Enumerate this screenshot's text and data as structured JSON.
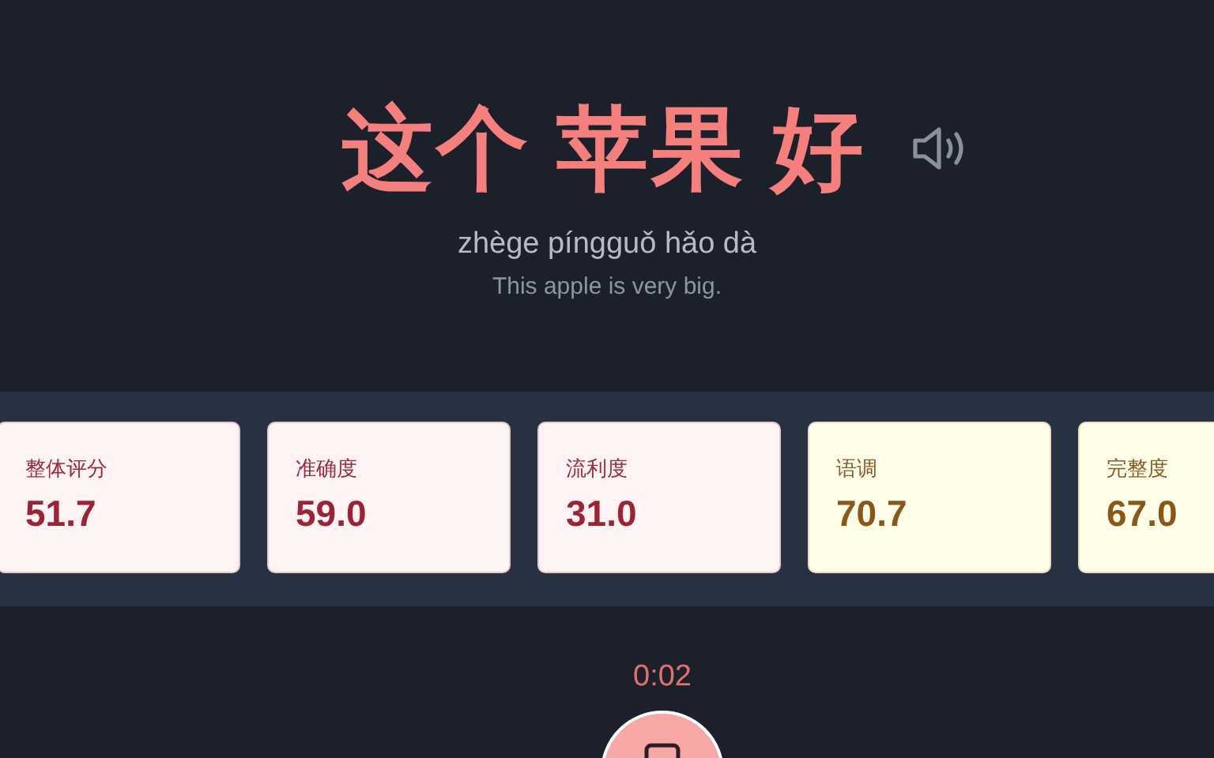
{
  "sentence": {
    "words": [
      {
        "text": "这个"
      },
      {
        "text": "苹果"
      },
      {
        "text": "好"
      }
    ],
    "pinyin": "zhège píngguǒ hǎo dà",
    "translation": "This apple is very big."
  },
  "scores": [
    {
      "label": "整体评分",
      "value": "51.7",
      "kind": "low"
    },
    {
      "label": "准确度",
      "value": "59.0",
      "kind": "low"
    },
    {
      "label": "流利度",
      "value": "31.0",
      "kind": "low"
    },
    {
      "label": "语调",
      "value": "70.7",
      "kind": "mid"
    },
    {
      "label": "完整度",
      "value": "67.0",
      "kind": "mid"
    }
  ],
  "recorder": {
    "timer": "0:02"
  }
}
